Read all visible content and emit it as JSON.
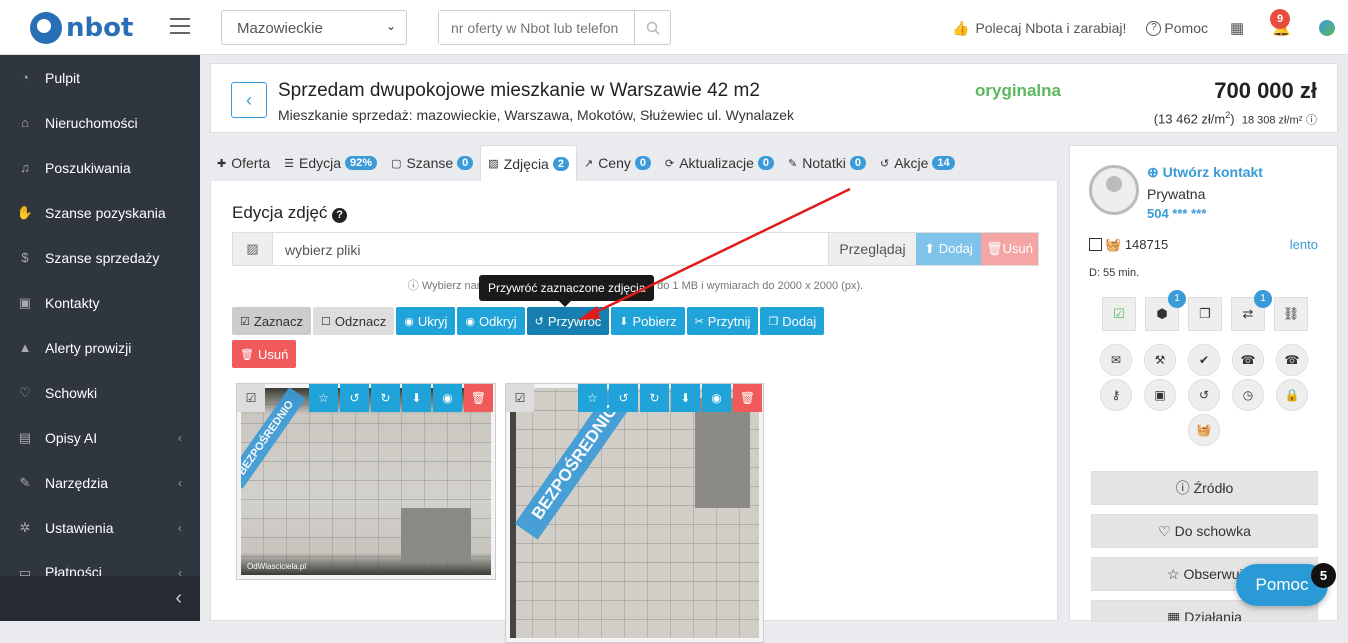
{
  "brand": {
    "name": "nbot"
  },
  "topbar": {
    "region": "Mazowieckie",
    "search_placeholder": "nr oferty w Nbot lub telefon",
    "refer": "Polecaj Nbota i zarabiaj!",
    "help": "Pomoc",
    "notifications": "9"
  },
  "sidebar": {
    "items": [
      {
        "label": "Pulpit",
        "icon": "dashboard-icon"
      },
      {
        "label": "Nieruchomości",
        "icon": "home-icon"
      },
      {
        "label": "Poszukiwania",
        "icon": "bell-icon"
      },
      {
        "label": "Szanse pozyskania",
        "icon": "handshake-icon"
      },
      {
        "label": "Szanse sprzedaży",
        "icon": "dollar-icon"
      },
      {
        "label": "Kontakty",
        "icon": "contact-icon"
      },
      {
        "label": "Alerty prowizji",
        "icon": "alert-icon"
      },
      {
        "label": "Schowki",
        "icon": "heart-icon"
      },
      {
        "label": "Opisy AI",
        "icon": "chat-icon"
      },
      {
        "label": "Narzędzia",
        "icon": "wrench-icon"
      },
      {
        "label": "Ustawienia",
        "icon": "gear-icon"
      },
      {
        "label": "Płatności",
        "icon": "card-icon"
      }
    ]
  },
  "listing": {
    "title": "Sprzedam dwupokojowe mieszkanie w Warszawie 42 m2",
    "subtitle": "Mieszkanie sprzedaż: mazowieckie, Warszawa, Mokotów, Służewiec ul. Wynalazek",
    "status": "oryginalna",
    "price": "700 000 zł",
    "price_m2": "(13 462 zł/m",
    "price_m2_sup": "2",
    "price_m2_close": ")",
    "avg_m2": "18 308 zł/m²"
  },
  "tabs": [
    {
      "label": "Oferta",
      "badge": ""
    },
    {
      "label": "Edycja",
      "badge": "92%"
    },
    {
      "label": "Szanse",
      "badge": "0"
    },
    {
      "label": "Zdjęcia",
      "badge": "2"
    },
    {
      "label": "Ceny",
      "badge": "0"
    },
    {
      "label": "Aktualizacje",
      "badge": "0"
    },
    {
      "label": "Notatki",
      "badge": "0"
    },
    {
      "label": "Akcje",
      "badge": "14"
    }
  ],
  "photos": {
    "title": "Edycja zdjęć",
    "file_placeholder": "wybierz pliki",
    "browse": "Przeglądaj",
    "add": "Dodaj",
    "remove": "Usuń",
    "hint": "Wybierz naraz do 10 zdjęć. W... png o wielkości do 1 MB i wymiarach do 2000 x 2000 (px).",
    "tooltip": "Przywróć zaznaczone zdjęcia",
    "actions": [
      "Zaznacz",
      "Odznacz",
      "Ukryj",
      "Odkryj",
      "Przywróć",
      "Pobierz",
      "Przytnij",
      "Dodaj"
    ],
    "delete": "Usuń",
    "ribbon": "BEZPOŚREDNIO",
    "watermark": "OdWlasciciela.pl"
  },
  "contact": {
    "create": "Utwórz kontakt",
    "type": "Prywatna",
    "phone": "504 *** ***",
    "id": "148715",
    "speed": "lento",
    "duration": "D: 55 min.",
    "badge_a": "1",
    "badge_b": "1",
    "buttons": [
      "Źródło",
      "Do schowka",
      "Obserwuj",
      "Działania"
    ]
  },
  "chat": {
    "label": "Pomoc",
    "count": "5"
  },
  "colors": {
    "accent": "#1fa3d8",
    "danger": "#f05a5a",
    "success": "#5cb85c",
    "sidebar": "#2f3640"
  }
}
